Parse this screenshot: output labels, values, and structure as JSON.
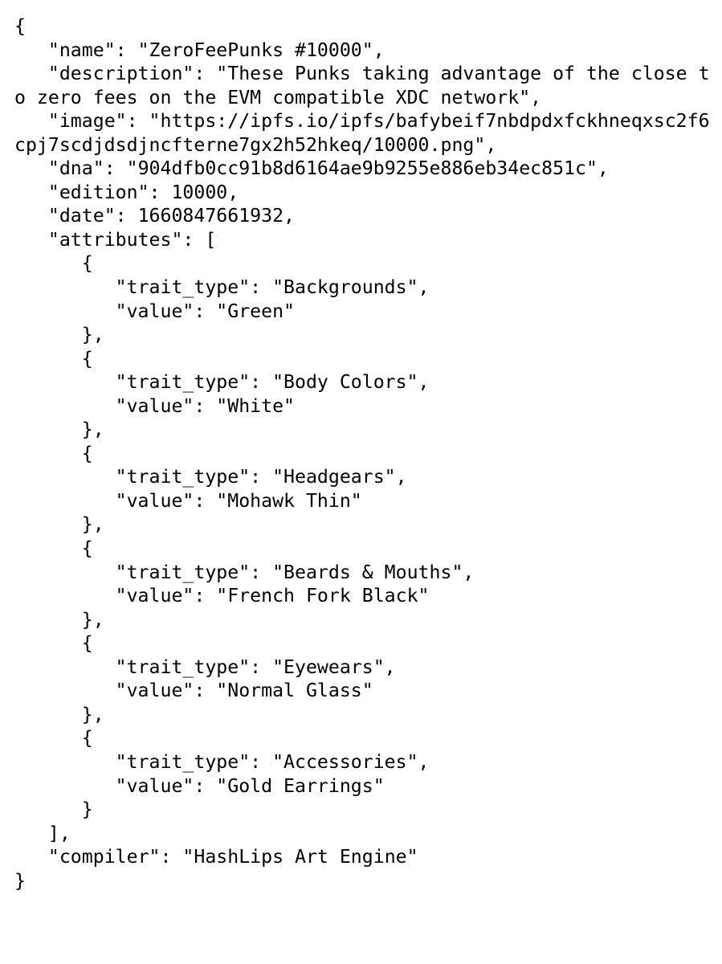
{
  "document": {
    "kind": "nft-metadata-json",
    "text_color": "#000000",
    "background_color": "#ffffff",
    "json_text": "{\n   \"name\": \"ZeroFeePunks #10000\",\n   \"description\": \"These Punks taking advantage of the close to zero fees on the EVM compatible XDC network\",\n   \"image\": \"https://ipfs.io/ipfs/bafybeif7nbdpdxfckhneqxsc2f6cpj7scdjdsdjncfterne7gx2h52hkeq/10000.png\",\n   \"dna\": \"904dfb0cc91b8d6164ae9b9255e886eb34ec851c\",\n   \"edition\": 10000,\n   \"date\": 1660847661932,\n   \"attributes\": [\n      {\n         \"trait_type\": \"Backgrounds\",\n         \"value\": \"Green\"\n      },\n      {\n         \"trait_type\": \"Body Colors\",\n         \"value\": \"White\"\n      },\n      {\n         \"trait_type\": \"Headgears\",\n         \"value\": \"Mohawk Thin\"\n      },\n      {\n         \"trait_type\": \"Beards & Mouths\",\n         \"value\": \"French Fork Black\"\n      },\n      {\n         \"trait_type\": \"Eyewears\",\n         \"value\": \"Normal Glass\"\n      },\n      {\n         \"trait_type\": \"Accessories\",\n         \"value\": \"Gold Earrings\"\n      }\n   ],\n   \"compiler\": \"HashLips Art Engine\"\n}"
  },
  "metadata": {
    "name": "ZeroFeePunks #10000",
    "description": "These Punks taking advantage of the close to zero fees on the EVM compatible XDC network",
    "image": "https://ipfs.io/ipfs/bafybeif7nbdpdxfckhneqxsc2f6cpj7scdjdsdjncfterne7gx2h52hkeq/10000.png",
    "dna": "904dfb0cc91b8d6164ae9b9255e886eb34ec851c",
    "edition": 10000,
    "date": 1660847661932,
    "attributes": [
      {
        "trait_type": "Backgrounds",
        "value": "Green"
      },
      {
        "trait_type": "Body Colors",
        "value": "White"
      },
      {
        "trait_type": "Headgears",
        "value": "Mohawk Thin"
      },
      {
        "trait_type": "Beards & Mouths",
        "value": "French Fork Black"
      },
      {
        "trait_type": "Eyewears",
        "value": "Normal Glass"
      },
      {
        "trait_type": "Accessories",
        "value": "Gold Earrings"
      }
    ],
    "compiler": "HashLips Art Engine"
  }
}
